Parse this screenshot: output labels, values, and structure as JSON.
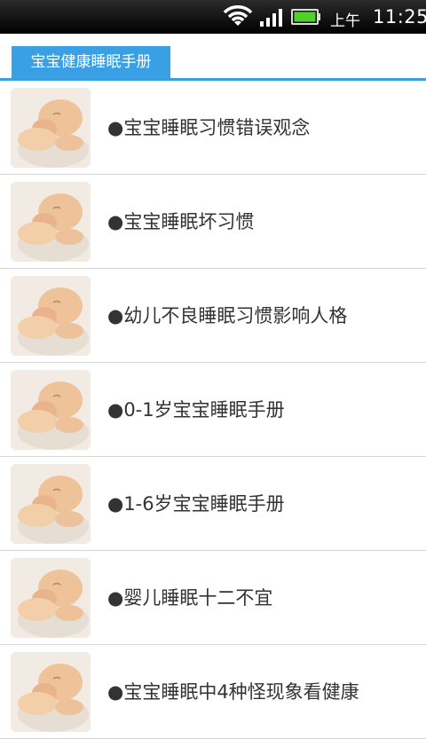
{
  "status_bar": {
    "ampm": "上午",
    "time": "11:25",
    "icons": [
      "wifi-icon",
      "signal-icon",
      "battery-icon"
    ],
    "battery_color": "#4fd12a"
  },
  "header": {
    "tab_label": "宝宝健康睡眠手册",
    "accent_color": "#3aa0e6"
  },
  "list": {
    "items": [
      {
        "label": "●宝宝睡眠习惯错误观念"
      },
      {
        "label": "●宝宝睡眠坏习惯"
      },
      {
        "label": "●幼儿不良睡眠习惯影响人格"
      },
      {
        "label": "●0-1岁宝宝睡眠手册"
      },
      {
        "label": "●1-6岁宝宝睡眠手册"
      },
      {
        "label": "●婴儿睡眠十二不宜"
      },
      {
        "label": "●宝宝睡眠中4种怪现象看健康"
      }
    ]
  }
}
